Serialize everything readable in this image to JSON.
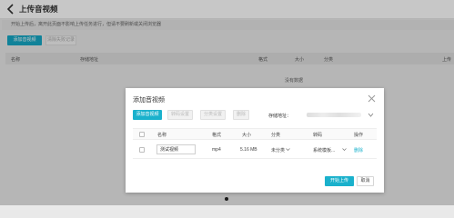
{
  "header": {
    "title": "上传音视频"
  },
  "notice": "开始上传后，离开此页面不影响上传任务进行，但请不要刷新或关闭浏览器",
  "bg_actions": {
    "add_label": "添加音视频",
    "clear_label": "清除失败记录"
  },
  "bg_table": {
    "columns": [
      "名称",
      "存储地址",
      "格式",
      "大小",
      "分类",
      "上传"
    ],
    "empty_text": "没有数据"
  },
  "dialog": {
    "title": "添加音视频",
    "toolbar": {
      "add_label": "添加音视频",
      "transcode_label": "转码设置",
      "category_label": "分类设置",
      "delete_label": "删除",
      "storage_label": "存储地址："
    },
    "table": {
      "columns": [
        "名称",
        "格式",
        "大小",
        "分类",
        "转码",
        "操作"
      ],
      "rows": [
        {
          "name_value": "测试视频",
          "format": "mp4",
          "size": "5.16 MB",
          "category": "未分类",
          "transcode": "系统模板...",
          "action": "删除"
        }
      ]
    },
    "footer": {
      "start_label": "开始上传",
      "cancel_label": "取消"
    }
  },
  "colors": {
    "accent": "#1ab1cc",
    "overlay": "rgba(0,0,0,0.22)"
  }
}
